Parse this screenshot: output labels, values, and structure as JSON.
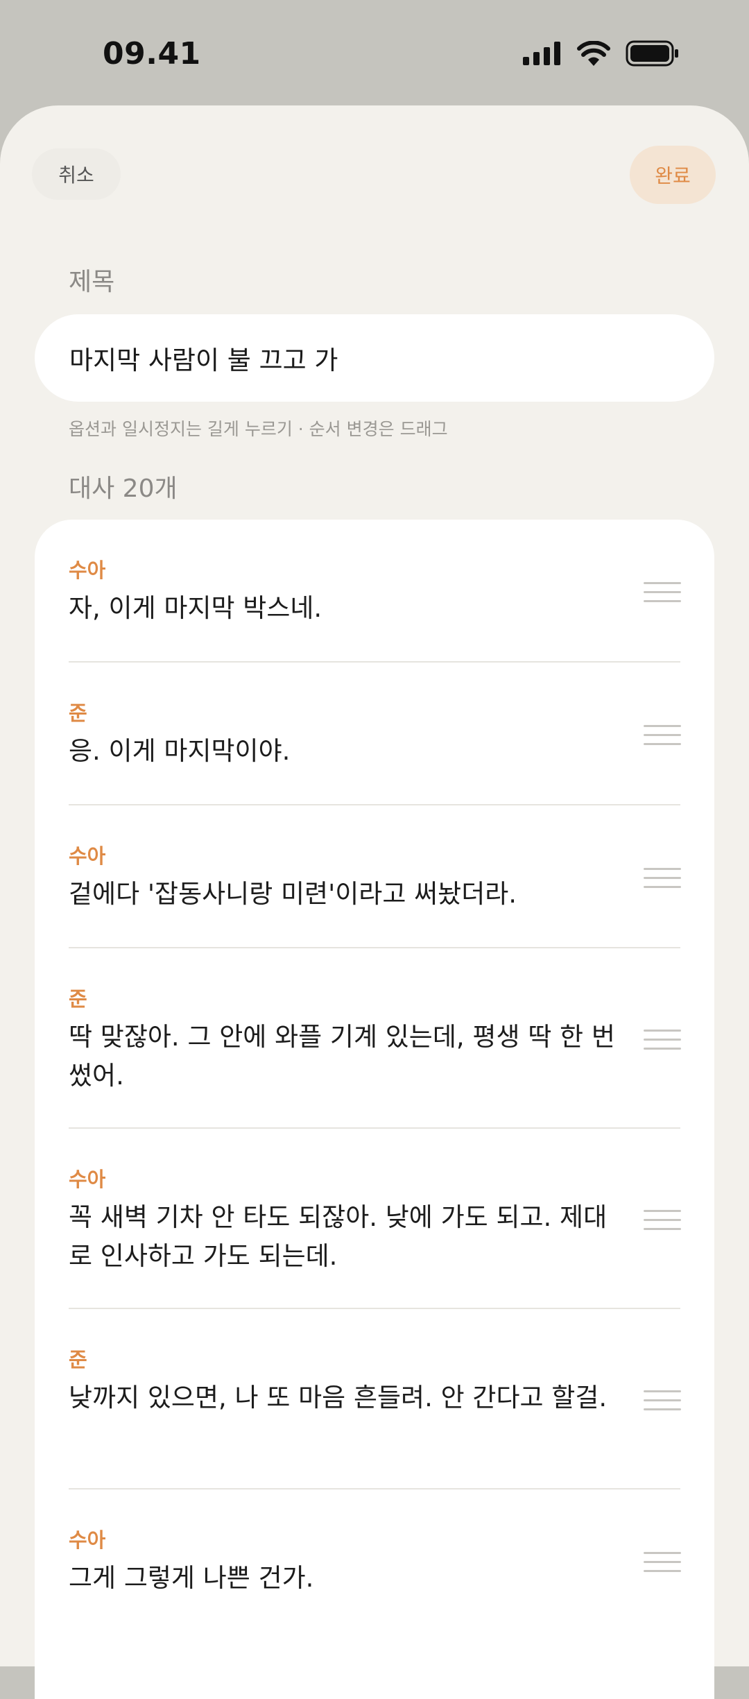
{
  "status_bar": {
    "time": "09.41",
    "icons": [
      "cellular-signal-icon",
      "wifi-icon",
      "battery-icon"
    ]
  },
  "header": {
    "cancel_label": "취소",
    "done_label": "완료"
  },
  "title_section": {
    "label": "제목",
    "value": "마지막 사람이 불 끄고 가",
    "hint": "옵션과 일시정지는 길게 누르기 · 순서 변경은 드래그"
  },
  "lines_section": {
    "label": "대사 20개",
    "items": [
      {
        "speaker": "수아",
        "text": "자, 이게 마지막 박스네."
      },
      {
        "speaker": "준",
        "text": "응. 이게 마지막이야."
      },
      {
        "speaker": "수아",
        "text": "겉에다 '잡동사니랑 미련'이라고 써놨더라."
      },
      {
        "speaker": "준",
        "text": "딱 맞잖아. 그 안에 와플 기계 있는데, 평생 딱 한 번 썼어."
      },
      {
        "speaker": "수아",
        "text": "꼭 새벽 기차 안 타도 되잖아. 낮에 가도 되고. 제대로 인사하고 가도 되는데."
      },
      {
        "speaker": "준",
        "text": "낮까지 있으면, 나 또 마음 흔들려. 안 간다고 할걸."
      },
      {
        "speaker": "수아",
        "text": "그게 그렇게 나쁜 건가."
      }
    ]
  },
  "colors": {
    "accent": "#df8a45",
    "sheet_background": "#f3f1ec",
    "status_background": "#c5c4be"
  }
}
